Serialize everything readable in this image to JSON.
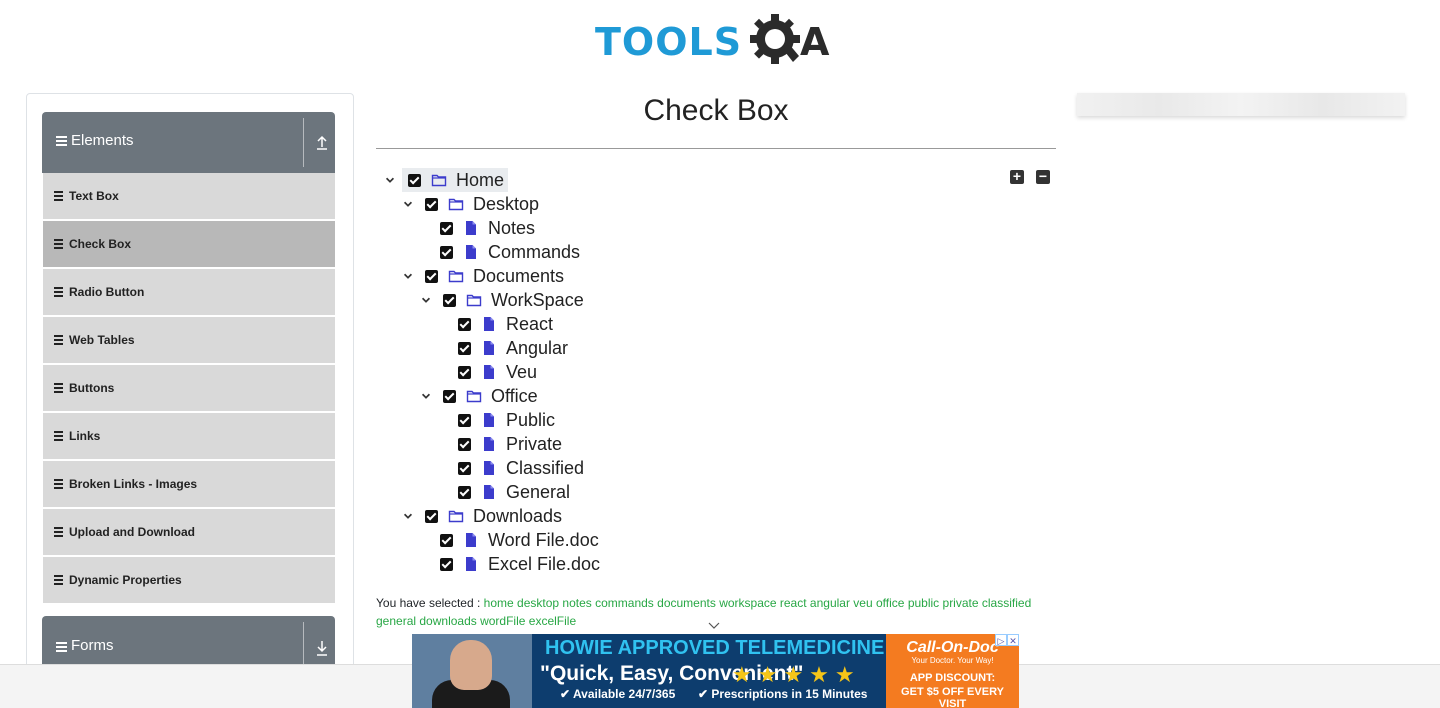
{
  "brand": {
    "logo_text": "TOOLS",
    "logo_tail": "A"
  },
  "sidebar": {
    "groups": [
      {
        "title": "Elements"
      },
      {
        "title": "Forms"
      }
    ],
    "items": [
      {
        "label": "Text Box"
      },
      {
        "label": "Check Box"
      },
      {
        "label": "Radio Button"
      },
      {
        "label": "Web Tables"
      },
      {
        "label": "Buttons"
      },
      {
        "label": "Links"
      },
      {
        "label": "Broken Links - Images"
      },
      {
        "label": "Upload and Download"
      },
      {
        "label": "Dynamic Properties"
      }
    ],
    "active_item": "Check Box"
  },
  "main": {
    "title": "Check Box",
    "tree": [
      {
        "label": "Home"
      },
      {
        "label": "Desktop"
      },
      {
        "label": "Notes"
      },
      {
        "label": "Commands"
      },
      {
        "label": "Documents"
      },
      {
        "label": "WorkSpace"
      },
      {
        "label": "React"
      },
      {
        "label": "Angular"
      },
      {
        "label": "Veu"
      },
      {
        "label": "Office"
      },
      {
        "label": "Public"
      },
      {
        "label": "Private"
      },
      {
        "label": "Classified"
      },
      {
        "label": "General"
      },
      {
        "label": "Downloads"
      },
      {
        "label": "Word File.doc"
      },
      {
        "label": "Excel File.doc"
      }
    ],
    "expand_all_label": "+",
    "collapse_all_label": "−",
    "result_prefix": "You have selected :",
    "selected": [
      "home",
      "desktop",
      "notes",
      "commands",
      "documents",
      "workspace",
      "react",
      "angular",
      "veu",
      "office",
      "public",
      "private",
      "classified",
      "general",
      "downloads",
      "wordFile",
      "excelFile"
    ]
  },
  "ad": {
    "headline": "HOWIE APPROVED TELEMEDICINE",
    "tagline": "\"Quick, Easy, Convenient\"",
    "stars": "★★★★★",
    "feature1": "✔ Available 24/7/365",
    "feature2": "✔ Prescriptions in 15 Minutes",
    "brand": "Call-On-Doc",
    "brand_sub": "Your Doctor. Your Way!",
    "discount1": "APP DISCOUNT:",
    "discount2": "GET $5 OFF EVERY VISIT"
  },
  "colors": {
    "brand_blue": "#1f9ad6",
    "sidebar_header": "#6c757d",
    "selected_green": "#28a745",
    "file_icon": "#3c3ccc"
  }
}
